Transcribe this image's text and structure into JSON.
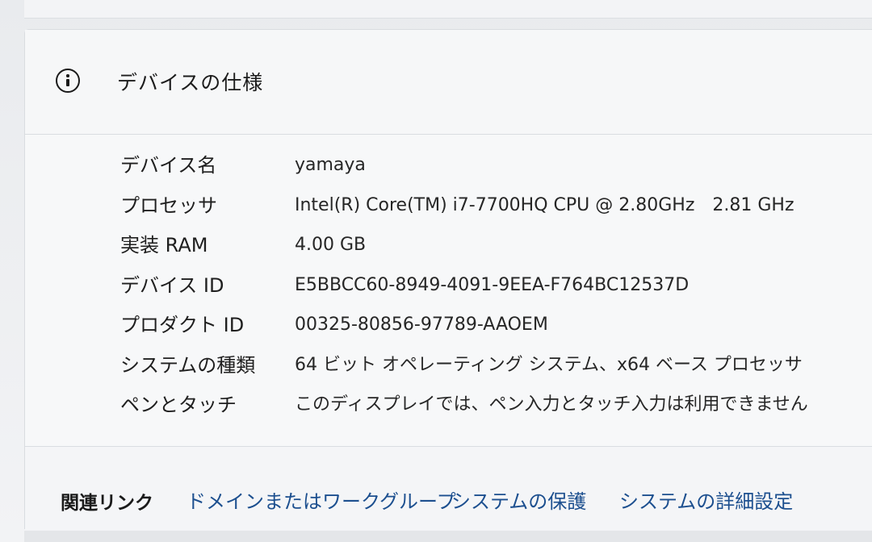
{
  "card": {
    "title": "デバイスの仕様",
    "icon": "info-icon"
  },
  "specs": [
    {
      "label": "デバイス名",
      "value": "yamaya"
    },
    {
      "label": "プロセッサ",
      "value": "Intel(R) Core(TM) i7-7700HQ CPU @ 2.80GHz",
      "value2": "2.81 GHz"
    },
    {
      "label": "実装 RAM",
      "value": "4.00 GB"
    },
    {
      "label": "デバイス ID",
      "value": "E5BBCC60-8949-4091-9EEA-F764BC12537D"
    },
    {
      "label": "プロダクト ID",
      "value": "00325-80856-97789-AAOEM"
    },
    {
      "label": "システムの種類",
      "value": "64 ビット オペレーティング システム、x64 ベース プロセッサ"
    },
    {
      "label": "ペンとタッチ",
      "value": "このディスプレイでは、ペン入力とタッチ入力は利用できません"
    }
  ],
  "related": {
    "label": "関連リンク",
    "links": [
      "ドメインまたはワークグループ",
      "システムの保護",
      "システムの詳細設定"
    ],
    "link_color": "#1c4f8f"
  }
}
